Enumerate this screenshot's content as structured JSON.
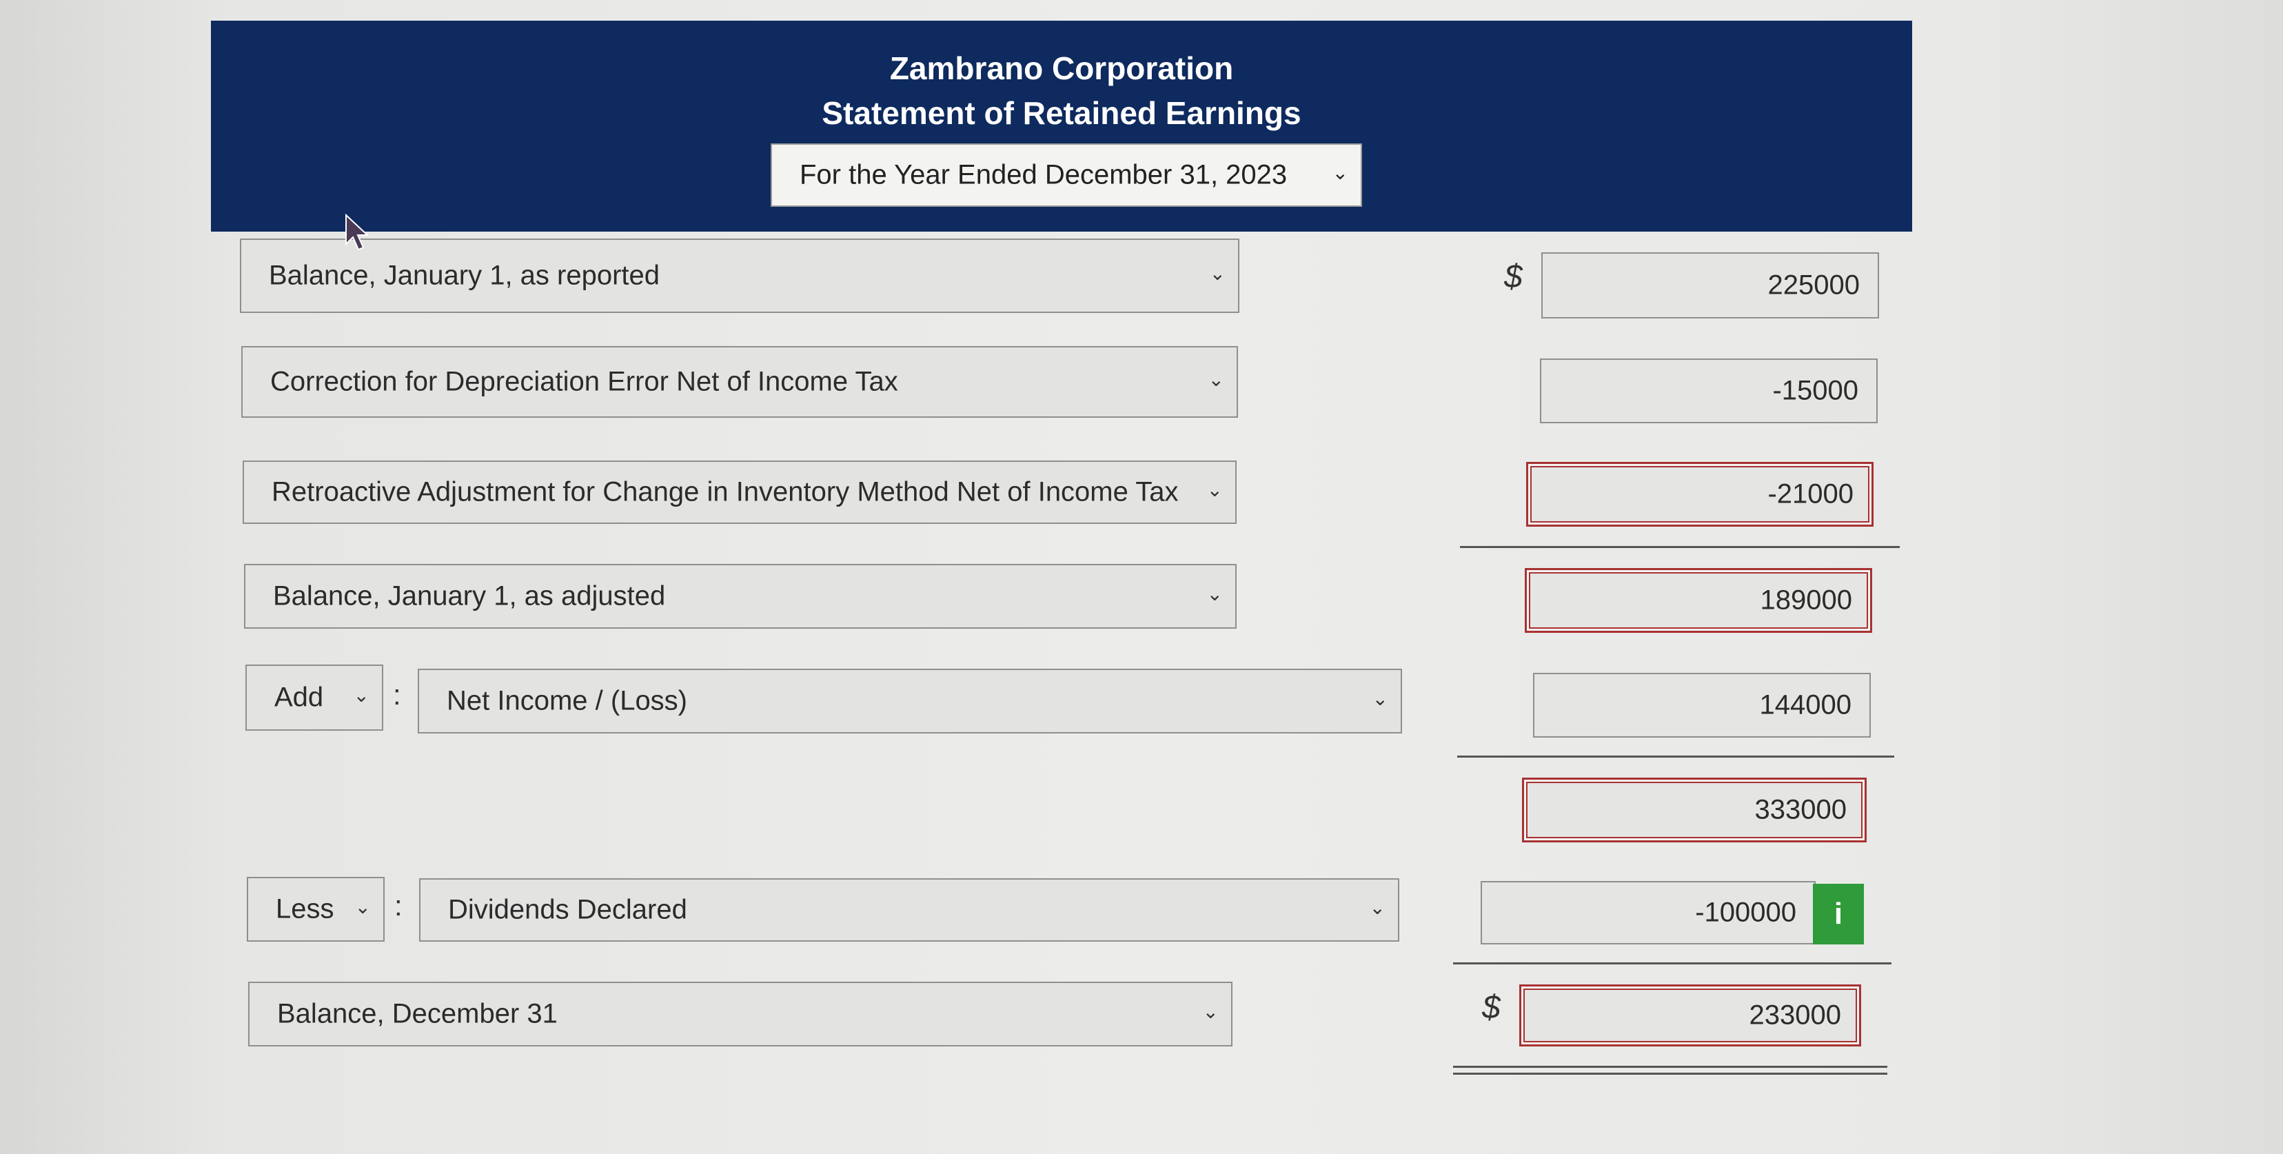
{
  "header": {
    "company": "Zambrano Corporation",
    "statement": "Statement of Retained Earnings",
    "period": "For the Year Ended December 31, 2023"
  },
  "rows": [
    {
      "label": "Balance, January 1, as reported",
      "amount": "225000"
    },
    {
      "label": "Correction for Depreciation Error Net of Income Tax",
      "amount": "-15000"
    },
    {
      "label": "Retroactive Adjustment for Change in Inventory Method Net of Income Tax",
      "amount": "-21000"
    },
    {
      "label": "Balance, January 1, as adjusted",
      "amount": "189000"
    },
    {
      "prefix": "Add",
      "label": "Net Income / (Loss)",
      "amount": "144000"
    },
    {
      "amount": "333000"
    },
    {
      "prefix": "Less",
      "label": "Dividends Declared",
      "amount": "-100000"
    },
    {
      "label": "Balance, December 31",
      "amount": "233000"
    }
  ],
  "symbols": {
    "dollar": "$",
    "colon": ":",
    "info": "i"
  },
  "colors": {
    "header_bg": "#0e2a5e",
    "error_border": "#a83232",
    "info_green": "#2f9b3a"
  }
}
